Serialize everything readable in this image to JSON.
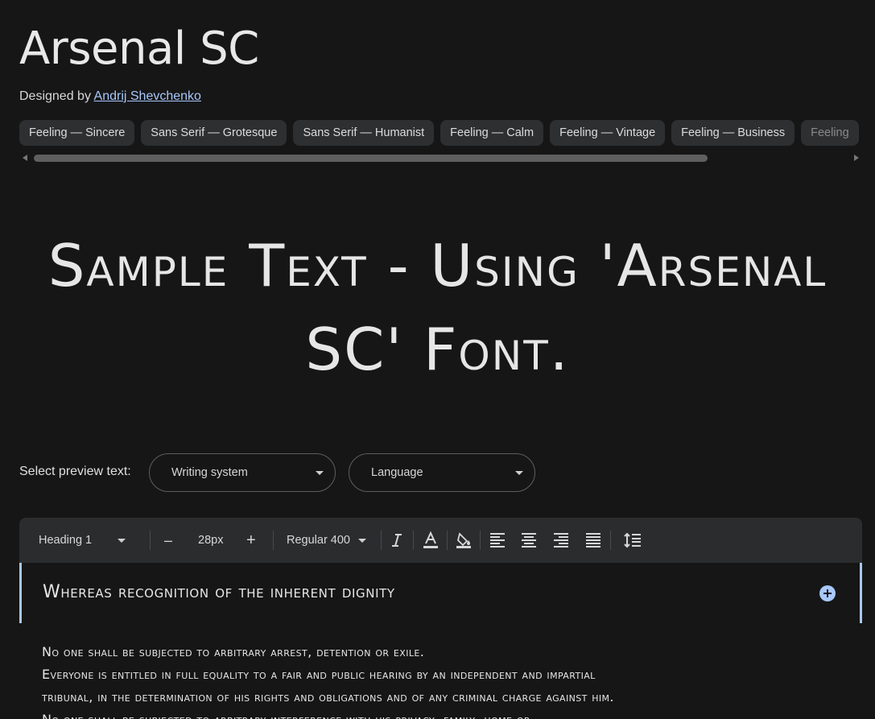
{
  "font": {
    "name": "Arsenal SC",
    "designed_by_label": "Designed by",
    "designer": "Andrij Shevchenko"
  },
  "tags": [
    "Feeling — Sincere",
    "Sans Serif — Grotesque",
    "Sans Serif — Humanist",
    "Feeling — Calm",
    "Feeling — Vintage",
    "Feeling — Business",
    "Feeling"
  ],
  "sample_text": "Sample Text - Using 'Arsenal SC' Font.",
  "preview": {
    "label": "Select preview text:",
    "writing_system": "Writing system",
    "language": "Language"
  },
  "toolbar": {
    "style": "Heading 1",
    "minus": "–",
    "size": "28px",
    "plus": "+",
    "weight": "Regular 400"
  },
  "editor": {
    "heading": "Whereas recognition of the inherent dignity",
    "lines": [
      "No one shall be subjected to arbitrary arrest, detention or exile.",
      "Everyone is entitled in full equality to a fair and public hearing by an independent and impartial",
      "tribunal, in the determination of his rights and obligations and of any criminal charge against him.",
      "No one shall be subjected to arbitrary interference with his privacy, family, home or"
    ]
  },
  "colors": {
    "background": "#161616",
    "accent": "#a8c7fa",
    "chip": "#2d2f31",
    "toolbar": "#2b2c2e"
  }
}
